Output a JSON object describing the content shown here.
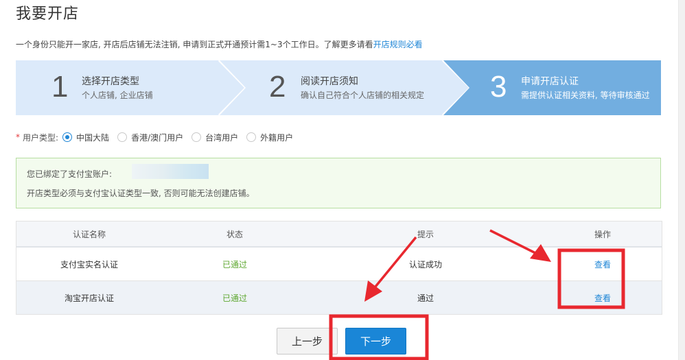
{
  "page": {
    "title": "我要开店"
  },
  "notice": {
    "text": "一个身份只能开一家店, 开店后店铺无法注销, 申请到正式开通预计需1~3个工作日。了解更多请看",
    "link": "开店规则必看"
  },
  "steps": [
    {
      "number": "1",
      "title": "选择开店类型",
      "desc": "个人店铺, 企业店铺"
    },
    {
      "number": "2",
      "title": "阅读开店须知",
      "desc": "确认自己符合个人店铺的相关规定"
    },
    {
      "number": "3",
      "title": "申请开店认证",
      "desc": "需提供认证相关资料, 等待审核通过"
    }
  ],
  "user_type": {
    "required_mark": "*",
    "label": "用户类型:",
    "options": [
      "中国大陆",
      "香港/澳门用户",
      "台湾用户",
      "外籍用户"
    ],
    "selected": "中国大陆"
  },
  "alert": {
    "line1": "您已绑定了支付宝账户:",
    "line2": "开店类型必须与支付宝认证类型一致, 否则可能无法创建店铺。"
  },
  "table": {
    "headers": [
      "认证名称",
      "状态",
      "提示",
      "操作"
    ],
    "rows": [
      {
        "name": "支付宝实名认证",
        "status": "已通过",
        "hint": "认证成功",
        "action": "查看"
      },
      {
        "name": "淘宝开店认证",
        "status": "已通过",
        "hint": "通过",
        "action": "查看"
      }
    ]
  },
  "buttons": {
    "prev": "上一步",
    "next": "下一步"
  },
  "colors": {
    "accent": "#1a86d7",
    "step_inactive": "#dceafa",
    "step_active": "#72aee0",
    "success": "#5fa832",
    "annotation_red": "#e8282f"
  }
}
